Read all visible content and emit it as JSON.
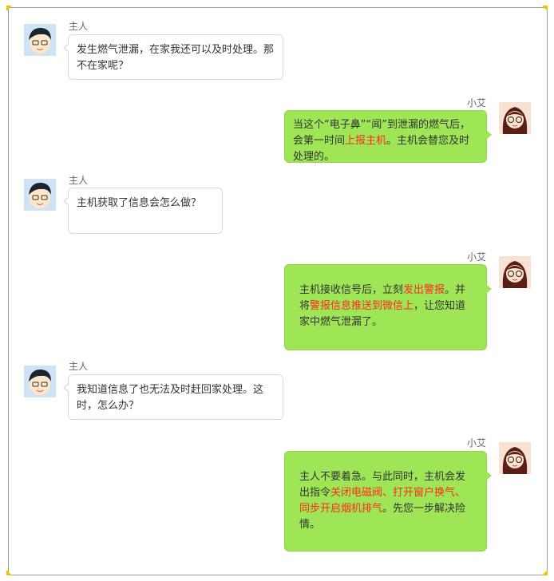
{
  "messages": [
    {
      "sender": "主人",
      "parts": [
        "发生燃气泄漏，在家我还可以及时处理。那不在家呢？"
      ]
    },
    {
      "sender": "小艾",
      "parts": [
        "当这个“电子鼻”“闻”到泄漏的燃气后，会第一时间",
        "上报主机",
        "。主机会替您及时处理的。"
      ]
    },
    {
      "sender": "主人",
      "parts": [
        "主机获取了信息会怎么做？"
      ]
    },
    {
      "sender": "小艾",
      "parts": [
        "主机接收信号后，立刻",
        "发出警报",
        "。并将",
        "警报信息推送到微信上",
        "，让您知道家中燃气泄漏了。"
      ]
    },
    {
      "sender": "主人",
      "parts": [
        "我知道信息了也无法及时赶回家处理。这时，怎么办？"
      ]
    },
    {
      "sender": "小艾",
      "parts": [
        "主人不要着急。与此同时，主机会发出指令",
        "关闭电磁阀、打开窗户换气、同步开启烟机排气",
        "。先您一步解决险情。"
      ]
    }
  ],
  "colors": {
    "highlight": "#ff2a1a",
    "reply_bubble": "#9ee655",
    "accent": "#f2c200"
  }
}
